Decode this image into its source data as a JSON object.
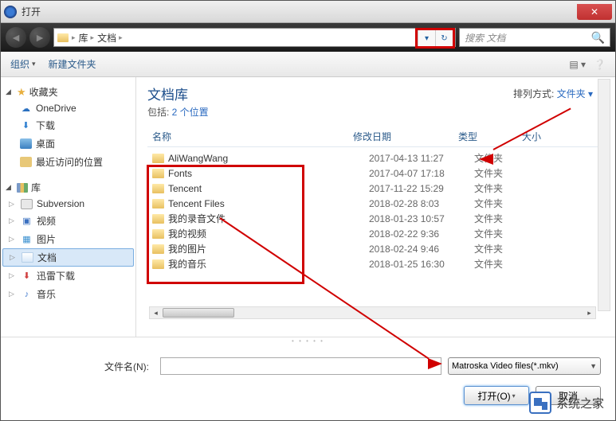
{
  "titlebar": {
    "title": "打开"
  },
  "breadcrumbs": [
    "库",
    "文档"
  ],
  "search": {
    "placeholder": "搜索 文档"
  },
  "toolbar": {
    "organize": "组织",
    "newfolder": "新建文件夹"
  },
  "sidebar": {
    "favorites_label": "收藏夹",
    "favorites": [
      {
        "label": "OneDrive",
        "ico": "ico-cloud",
        "glyph": "☁"
      },
      {
        "label": "下载",
        "ico": "ico-dl",
        "glyph": "⬇"
      },
      {
        "label": "桌面",
        "ico": "ico-desk",
        "glyph": ""
      },
      {
        "label": "最近访问的位置",
        "ico": "ico-recent",
        "glyph": ""
      }
    ],
    "libraries_label": "库",
    "libraries": [
      {
        "label": "Subversion",
        "ico": "ico-sub",
        "glyph": "",
        "tri": "▷"
      },
      {
        "label": "视频",
        "ico": "ico-vid",
        "glyph": "▣",
        "tri": "▷"
      },
      {
        "label": "图片",
        "ico": "ico-img",
        "glyph": "▦",
        "tri": "▷"
      },
      {
        "label": "文档",
        "ico": "ico-doc",
        "glyph": "",
        "tri": "▷",
        "sel": true
      },
      {
        "label": "迅雷下载",
        "ico": "ico-xl",
        "glyph": "⬇",
        "tri": "▷"
      },
      {
        "label": "音乐",
        "ico": "ico-mus",
        "glyph": "♪",
        "tri": "▷"
      }
    ]
  },
  "library_header": {
    "title": "文档库",
    "subtitle_prefix": "包括: ",
    "subtitle_link": "2 个位置",
    "sort_label": "排列方式:",
    "sort_value": "文件夹"
  },
  "columns": {
    "name": "名称",
    "date": "修改日期",
    "type": "类型",
    "size": "大小"
  },
  "files": [
    {
      "name": "AliWangWang",
      "date": "2017-04-13 11:27",
      "type": "文件夹"
    },
    {
      "name": "Fonts",
      "date": "2017-04-07 17:18",
      "type": "文件夹"
    },
    {
      "name": "Tencent",
      "date": "2017-11-22 15:29",
      "type": "文件夹"
    },
    {
      "name": "Tencent Files",
      "date": "2018-02-28 8:03",
      "type": "文件夹"
    },
    {
      "name": "我的录音文件",
      "date": "2018-01-23 10:57",
      "type": "文件夹"
    },
    {
      "name": "我的视频",
      "date": "2018-02-22 9:36",
      "type": "文件夹"
    },
    {
      "name": "我的图片",
      "date": "2018-02-24 9:46",
      "type": "文件夹"
    },
    {
      "name": "我的音乐",
      "date": "2018-01-25 16:30",
      "type": "文件夹"
    }
  ],
  "footer": {
    "filename_label": "文件名(N):",
    "filter_value": "Matroska Video files(*.mkv)",
    "open_btn": "打开(O)",
    "cancel_btn": "取消"
  },
  "watermark": "系统之家"
}
